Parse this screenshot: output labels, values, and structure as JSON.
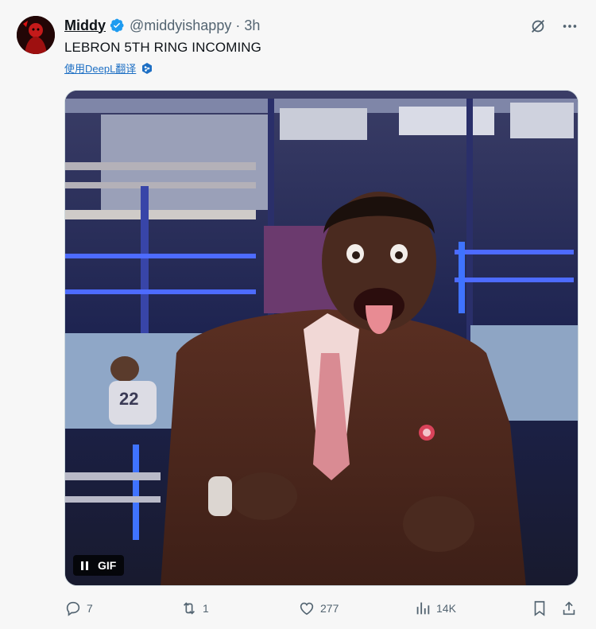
{
  "tweet": {
    "display_name": "Middy",
    "handle": "@middyishappy",
    "separator": "·",
    "time": "3h",
    "text": "LEBRON 5TH RING INCOMING",
    "translate_label": "使用DeepL翻译"
  },
  "media": {
    "badge_label": "GIF",
    "jersey_number": "22"
  },
  "actions": {
    "replies": "7",
    "reposts": "1",
    "likes": "277",
    "views": "14K"
  },
  "icons": {
    "verified": "verified-badge-icon",
    "grok": "grok-icon",
    "more": "more-icon",
    "deepl": "deepl-icon",
    "pause": "pause-icon",
    "reply": "reply-icon",
    "repost": "repost-icon",
    "like": "like-icon",
    "views": "views-icon",
    "bookmark": "bookmark-icon",
    "share": "share-icon"
  },
  "colors": {
    "verified": "#1d9bf0",
    "link": "#1d6fc4",
    "muted": "#536471",
    "text": "#0f1419"
  }
}
